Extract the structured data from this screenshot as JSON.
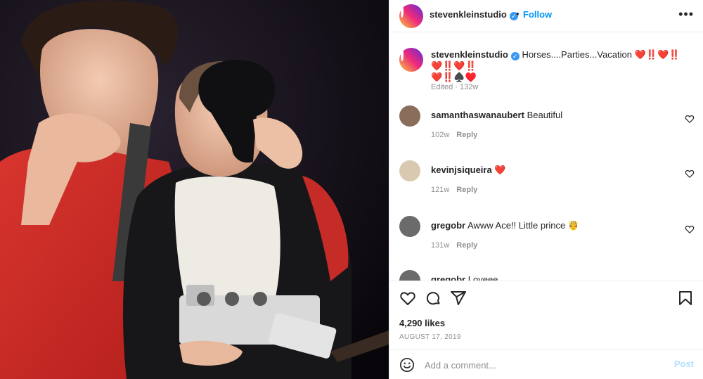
{
  "photo": {
    "alt_label": ""
  },
  "header": {
    "username": "stevenkleinstudio",
    "verified_mark": "✓",
    "dot": "•",
    "follow_label": "Follow",
    "more_label": "•••"
  },
  "caption": {
    "username": "stevenkleinstudio",
    "verified_mark": "✓",
    "text": "Horses....Parties...Vacation",
    "emoji_line1": "❤️‼️❤️‼️❤️‼️❤️‼️",
    "emoji_line2": "❤️‼️♠️♥️",
    "meta": "Edited · 132w"
  },
  "comments": [
    {
      "username": "samanthaswanaubert",
      "text": "Beautiful",
      "time": "102w",
      "reply": "Reply",
      "avatar_color": "#8a6d5b"
    },
    {
      "username": "kevinjsiqueira",
      "text": "❤️",
      "time": "121w",
      "reply": "Reply",
      "avatar_color": "#d9c9b0"
    },
    {
      "username": "gregobr",
      "text": "Awww Ace!! Little prince 🤴",
      "time": "131w",
      "reply": "Reply",
      "avatar_color": "#6b6b6b"
    },
    {
      "username": "gregobr",
      "text": "Loveee",
      "time": "",
      "reply": "",
      "avatar_color": "#6b6b6b"
    }
  ],
  "actions": {
    "likes": "4,290 likes",
    "date": "AUGUST 17, 2019",
    "icons": [
      "heart-icon",
      "comment-icon",
      "share-icon",
      "bookmark-icon"
    ]
  },
  "add_comment": {
    "placeholder": "Add a comment...",
    "post_label": "Post"
  },
  "colors": {
    "accent": "#0095f6",
    "post_disabled": "#b2dffc",
    "muted": "#8e8e8e",
    "text": "#262626",
    "heart": "#e0203a"
  }
}
